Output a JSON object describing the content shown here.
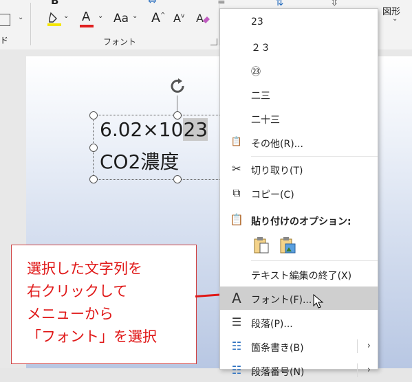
{
  "ribbon": {
    "font_group_label": "フォント",
    "zukei_label": "図形",
    "left_fragment": "ド",
    "bold": "B",
    "aa_label": "Aa",
    "grow_font": "A",
    "shrink_font": "A",
    "font_color_letter": "A",
    "highlight_color": "#f5e600",
    "font_color": "#e02020"
  },
  "slide": {
    "line1_prefix": "6.02×10",
    "line1_selected": "23",
    "line2": "CO2濃度"
  },
  "callout": {
    "text": "選択した文字列を\n右クリックして\nメニューから\n「フォント」を選択"
  },
  "menu": {
    "items": [
      {
        "label": "23"
      },
      {
        "label": "２３"
      },
      {
        "label": "㉓"
      },
      {
        "label": "二三"
      },
      {
        "label": "二十三"
      },
      {
        "label": "その他(R)..."
      },
      {
        "label": "切り取り(T)"
      },
      {
        "label": "コピー(C)"
      },
      {
        "label": "貼り付けのオプション:"
      },
      {
        "label": "テキスト編集の終了(X)"
      },
      {
        "label": "フォント(F)..."
      },
      {
        "label": "段落(P)..."
      },
      {
        "label": "箇条書き(B)"
      },
      {
        "label": "段落番号(N)"
      }
    ]
  }
}
